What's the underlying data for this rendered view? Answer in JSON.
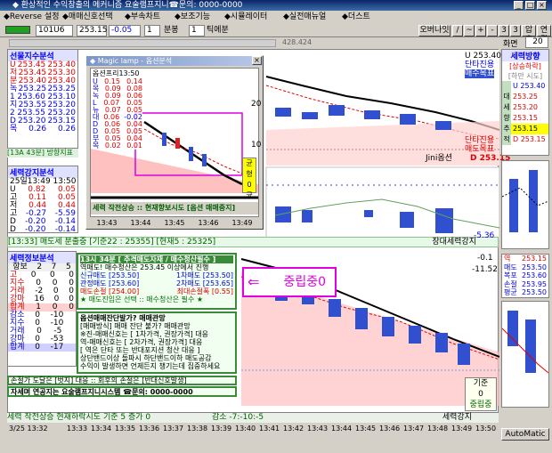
{
  "window": {
    "title": "◆ 환상적인 수익창출의 메커니즘 요술램프지니☎문의: 0000-0000"
  },
  "menu": [
    "◆Reverse 설정",
    "◆매매신호선택",
    "◆부속차트",
    "◆보조기능",
    "◆시뮬레이터",
    "◆실전매뉴얼",
    "◆더스트"
  ],
  "toolbar": {
    "code": "101U6",
    "price": "253.15",
    "change": "-0.05",
    "period_value": "1",
    "period_unit": "분봉",
    "count_value": "1",
    "count_unit": "틱에분",
    "overlay_btn": "오버나잇",
    "slash_btn": "/",
    "tilde_btn": "~",
    "plus_btn": "+",
    "minus_btn": "-",
    "n3_btn": "3",
    "check_btn": "3",
    "compress_btn": "압축",
    "link_btn": "연결",
    "screen_label": "화면",
    "screen_value": "20",
    "lamp": "428.424"
  },
  "left_panel": {
    "title": "선물지수분석",
    "rows": [
      {
        "k": "U",
        "a": "253.45",
        "b": "253.40"
      },
      {
        "k": "저",
        "a": "253.45",
        "b": "253.30"
      },
      {
        "k": "분",
        "a": "253.40",
        "b": "253.40"
      },
      {
        "k": "녹",
        "a": "253.25",
        "b": "253.25"
      },
      {
        "k": "1",
        "a": "253.60",
        "b": "253.10"
      },
      {
        "k": "지",
        "a": "253.55",
        "b": "253.20"
      },
      {
        "k": "2",
        "a": "253.55",
        "b": "253.20"
      },
      {
        "k": "D",
        "a": "253.20",
        "b": "253.15"
      },
      {
        "k": "목",
        "a": "0.26",
        "b": "0.26"
      }
    ],
    "footer": "[13A 43분] 방향지표"
  },
  "force_panel": {
    "title": "세력강지분석",
    "date": "25일13:49",
    "time2": "13:50",
    "rows": [
      {
        "k": "U",
        "a": "0.82",
        "b": "0.05"
      },
      {
        "k": "고",
        "a": "0.11",
        "b": "0.05"
      },
      {
        "k": "저",
        "a": "0.44",
        "b": "0.44"
      },
      {
        "k": "고",
        "a": "-0.27",
        "b": "-5.59"
      },
      {
        "k": "D",
        "a": "-0.20",
        "b": "-0.14"
      },
      {
        "k": "D",
        "a": "-0.20",
        "b": "-0.14"
      }
    ]
  },
  "hint_bar": {
    "text": "[13:33] 매도세 분출중 [기준22 : 25355] [현재5 : 25325]",
    "right": "장대세력강지"
  },
  "pattern_panel": {
    "title": "세력정보분석",
    "header": [
      "항보",
      "2",
      "7",
      "5"
    ],
    "rows": [
      {
        "k": "고",
        "a": "0",
        "b": "0",
        "c": "0"
      },
      {
        "k": "지수",
        "a": "0",
        "b": "0",
        "c": "0"
      },
      {
        "k": "거래",
        "a": "-2",
        "b": "0",
        "c": "0"
      },
      {
        "k": "강마",
        "a": "16",
        "b": "0",
        "c": "0"
      },
      {
        "k": "합계",
        "a": "1",
        "b": "0",
        "c": "0"
      },
      {
        "k": "감소",
        "a": "0",
        "b": "-10",
        "c": ""
      },
      {
        "k": "지수",
        "a": "0",
        "b": "-10",
        "c": ""
      },
      {
        "k": "거래",
        "a": "0",
        "b": "-5",
        "c": ""
      },
      {
        "k": "강마",
        "a": "0",
        "b": "-53",
        "c": ""
      },
      {
        "k": "합계",
        "a": "0",
        "b": "-17",
        "c": ""
      }
    ]
  },
  "signal_box": {
    "line1": "13시 34분 [ 추격매도자재 / 매수청산필수 ]",
    "line2": "역매도! 매수청산은 253.45 이상에서 진행",
    "row_a": [
      "신규매도 [253.50]",
      "1차매도 [253.50]"
    ],
    "row_b": [
      "관정매도 [253.60]",
      "2차매도 [253.65]"
    ],
    "row_c": [
      "매도손절 [254.00]",
      "최대손절폭 [0.55]"
    ],
    "line6": "★ 매도진입은 선택 :: 매수청산은 필수 ★"
  },
  "callout": "중립중0",
  "advice_box": {
    "q": "옵션매매잔단발가? 매매관망",
    "l1": "[매매방식] 매매 잔단 불가? 매매관망",
    "l2": "※진-매매신호는 [ 1차가격, 권장가격] 대응",
    "l3": "역-매매신호는 [ 2차가격, 권장가격] 대응",
    "l4": "[ 역은 단타 또는 반대포지션 청산 대응 ]",
    "l5": "상단밴드이상 돌파시 하단밴드이하 매도공감",
    "l6": "수익이 발생하면 언제든지 챙기는데 집중하세요"
  },
  "warn_line": "손절가 도달은 [벗지] 대응 :: 회후의 손절은 [반대신호발생]",
  "contact_line": "자세며 연공지는 요술램프지니시스템 ☎문의: 0000-0000",
  "popup": {
    "title": "◆ Magic lamp - 옵션분석",
    "sub": "옵션프리13:50",
    "rows": [
      {
        "k": "U",
        "a": "0.15",
        "b": "0.14"
      },
      {
        "k": "목",
        "a": "0.09",
        "b": "0.08"
      },
      {
        "k": "녹",
        "a": "0.09",
        "b": "0.06"
      },
      {
        "k": "L",
        "a": "0.07",
        "b": "0.05"
      },
      {
        "k": "뉴",
        "a": "0.07",
        "b": "0.05"
      },
      {
        "k": "대",
        "a": "0.06",
        "b": "-0.02"
      },
      {
        "k": "D",
        "a": "0.06",
        "b": "0.04"
      },
      {
        "k": "D",
        "a": "0.05",
        "b": "0.05"
      },
      {
        "k": "부",
        "a": "0.05",
        "b": "0.04"
      },
      {
        "k": "목",
        "a": "0.02",
        "b": "0.01"
      }
    ],
    "side": [
      "균형",
      "0",
      "균형"
    ],
    "status": "세력 작전상승 :: 현재향보시도 [옵션 매매중지]",
    "times": [
      "13:43",
      "13:44",
      "13:45",
      "13:46",
      "13:49"
    ]
  },
  "right_panel": {
    "title1": "세력방향",
    "sub1": "[상승하락]",
    "sub2": "[하만 시도]",
    "vals": [
      "U 253.40",
      "253.25",
      "253.20",
      "253.15",
      "253.15",
      "D 253.15"
    ],
    "tags": [
      "대",
      "세",
      "향",
      "추",
      "적"
    ],
    "bottom_title": "역",
    "bottom_vals": [
      "253.15",
      "253.50",
      "253.60",
      "253.95",
      "253.50"
    ],
    "bottom_keys": [
      "역",
      "매도",
      "복포",
      "손절",
      "평균"
    ],
    "automatic": "AutoMatic"
  },
  "right_chart_tags": {
    "t1": "U 253.40",
    "t2": "단타진용",
    "t3": "매수목표",
    "t4": "단타진용",
    "t5": "매도목표",
    "t6": "D 253.15",
    "jini": "Jini옵션",
    "v1": "-5.36",
    "v2": "-0.1",
    "v3": "-11.52",
    "y20": "20",
    "y10": "10",
    "gijun": "기준",
    "zero": "0",
    "jungrip": "중립중"
  },
  "status": {
    "left": "세력 작전상승 현재하락시도 기준 5 증가 0",
    "mid": "감소 -7:-10:-5",
    "right": "세력강지"
  },
  "time_axis": [
    "3/25 13:32",
    "13:33",
    "13:34",
    "13:35",
    "13:36",
    "13:37",
    "13:38",
    "13:39",
    "13:40",
    "13:41",
    "13:42",
    "13:43",
    "13:44",
    "13:45",
    "13:46",
    "13:47",
    "13:48",
    "13:49",
    "13:50"
  ],
  "colors": {
    "accent": "#0a246a",
    "up": "#e00000",
    "down": "#0000e0",
    "green": "#3a8a3a",
    "magenta": "#e000e0"
  }
}
